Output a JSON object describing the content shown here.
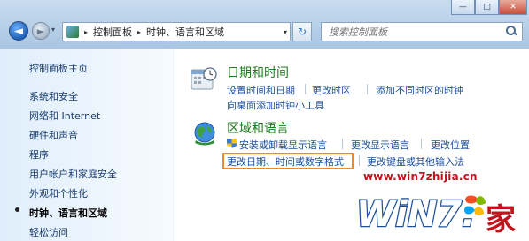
{
  "window": {
    "minimize_glyph": "—",
    "maximize_glyph": "□",
    "close_glyph": "✕"
  },
  "nav": {
    "back_glyph": "◄",
    "forward_glyph": "►",
    "dropdown_glyph": "▾",
    "breadcrumb": [
      "控制面板",
      "时钟、语言和区域"
    ],
    "breadcrumb_sep": "▸",
    "refresh_glyph": "↻",
    "search_placeholder": "搜索控制面板"
  },
  "sidebar": {
    "items": [
      {
        "label": "控制面板主页",
        "current": false
      },
      {
        "label": "系统和安全",
        "current": false
      },
      {
        "label": "网络和 Internet",
        "current": false
      },
      {
        "label": "硬件和声音",
        "current": false
      },
      {
        "label": "程序",
        "current": false
      },
      {
        "label": "用户帐户和家庭安全",
        "current": false
      },
      {
        "label": "外观和个性化",
        "current": false
      },
      {
        "label": "时钟、语言和区域",
        "current": true
      },
      {
        "label": "轻松访问",
        "current": false
      }
    ]
  },
  "categories": [
    {
      "title": "日期和时间",
      "icon": "clock-icon",
      "links": [
        "设置时间和日期",
        "更改时区",
        "添加不同时区的时钟",
        "向桌面添加时钟小工具"
      ]
    },
    {
      "title": "区域和语言",
      "icon": "globe-icon",
      "links": [
        "安装或卸载显示语言",
        "更改显示语言",
        "更改位置",
        "更改日期、时间或数字格式",
        "更改键盘或其他输入法"
      ]
    }
  ],
  "watermark": {
    "url": "www.win7zhijia.cn",
    "logo_text": "WiN7.",
    "logo_char": "家"
  },
  "colors": {
    "link": "#1e50a2",
    "category_title": "#1f7a1f",
    "highlight_box": "#e98a2f",
    "watermark_red": "#c0141d"
  }
}
